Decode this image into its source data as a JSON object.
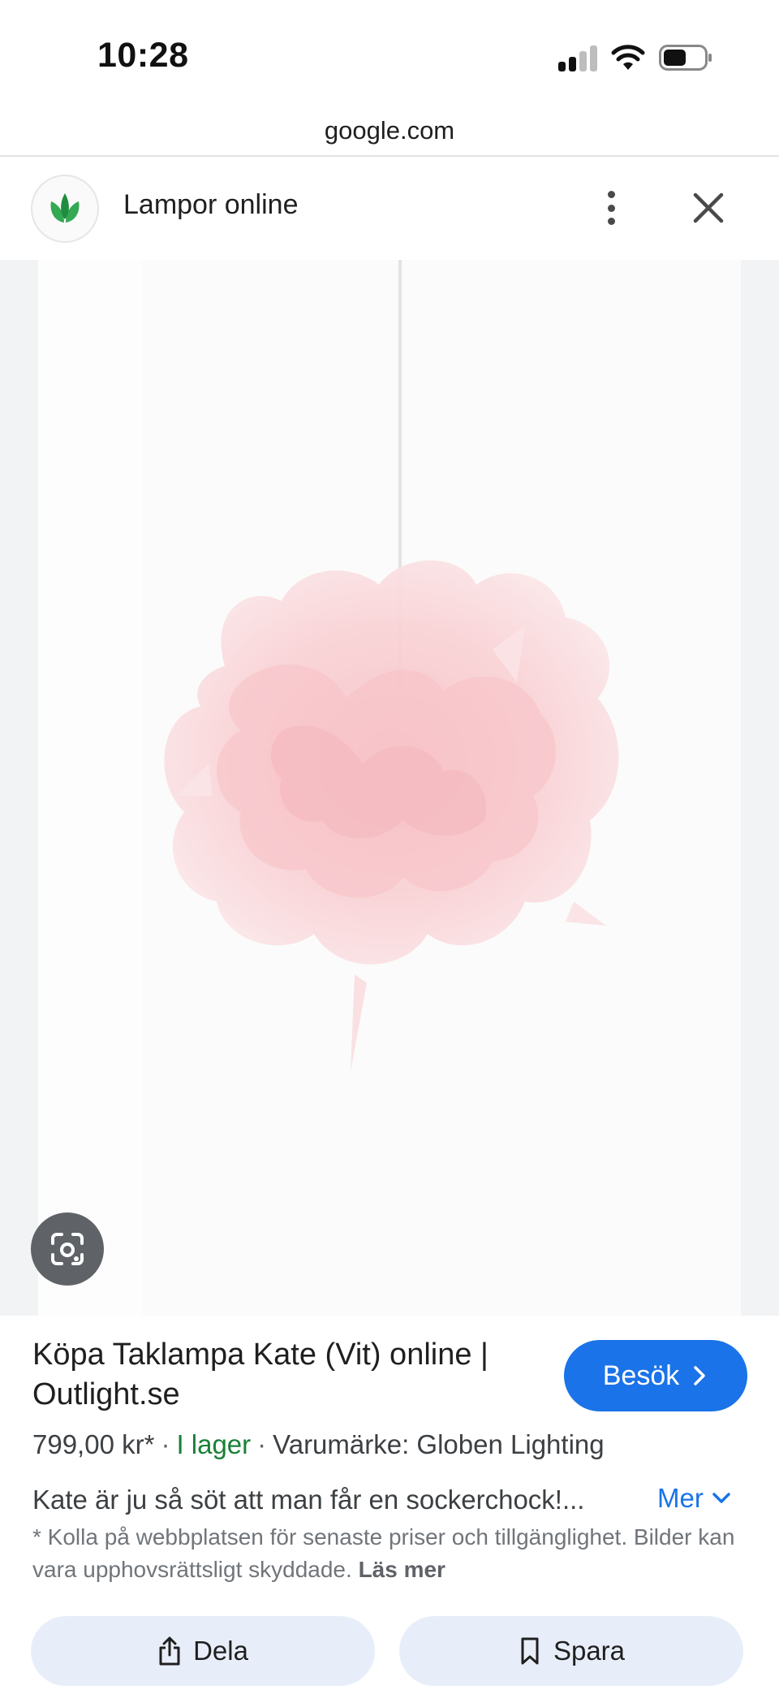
{
  "status_bar": {
    "time": "10:28"
  },
  "browser": {
    "url": "google.com"
  },
  "header": {
    "title": "Lampor online"
  },
  "product": {
    "title": "Köpa Taklampa Kate (Vit) online | Outlight.se",
    "visit_label": "Besök",
    "price": "799,00 kr*",
    "stock": "I lager",
    "brand": "Varumärke: Globen Lighting",
    "description": "Kate är ju så söt att man får en sockerchock!...",
    "more_label": "Mer",
    "disclaimer": "* Kolla på webbplatsen för senaste priser och tillgänglighet. Bilder kan vara upphovsrättsligt skyddade.",
    "read_more": "Läs mer"
  },
  "actions": {
    "share_label": "Dela",
    "save_label": "Spara"
  },
  "colors": {
    "accent": "#1a73e8",
    "stock_green": "#188038",
    "action_bg": "#e8eef9"
  },
  "icons": [
    "signal-icon",
    "wifi-icon",
    "battery-icon",
    "site-logo-icon",
    "more-vert-icon",
    "close-icon",
    "lens-icon",
    "chevron-right-icon",
    "chevron-down-icon",
    "share-icon",
    "bookmark-icon"
  ]
}
